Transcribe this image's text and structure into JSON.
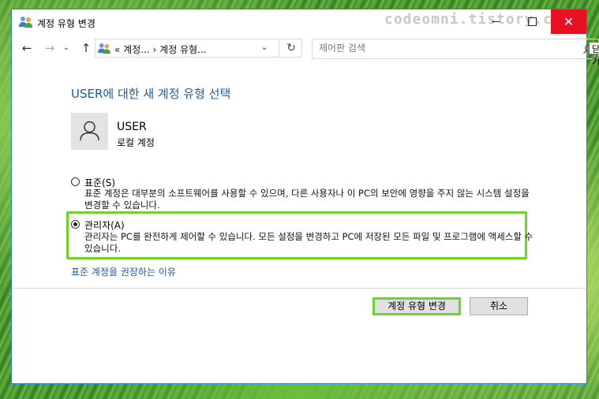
{
  "window": {
    "title": "계정 유형 변경",
    "close_tooltip": "닫기",
    "watermark": "codeomni.tistory.com"
  },
  "navigation": {
    "breadcrumb": {
      "overflow": "«",
      "items": [
        "계정...",
        "계정 유형..."
      ],
      "separator": "›"
    },
    "search": {
      "placeholder": "제어판 검색",
      "value": ""
    }
  },
  "content": {
    "heading": "USER에 대한 새 계정 유형 선택",
    "user": {
      "name": "USER",
      "account_type": "로컬 계정"
    },
    "options": [
      {
        "label": "표준(S)",
        "selected": false,
        "description": "표준 계정은 대부분의 소프트웨어를 사용할 수 있으며, 다른 사용자나 이 PC의 보안에 영향을 주지 않는 시스템 설정을 변경할 수 있습니다."
      },
      {
        "label": "관리자(A)",
        "selected": true,
        "description": "관리자는 PC를 완전하게 제어할 수 있습니다. 모든 설정을 변경하고 PC에 저장된 모든 파일 및 프로그램에 액세스할 수 있습니다."
      }
    ],
    "why_link": "표준 계정을 권장하는 이유"
  },
  "buttons": {
    "change": "계정 유형 변경",
    "cancel": "취소"
  },
  "colors": {
    "accent_blue": "#1e5aa8",
    "highlight_green": "#6fd426",
    "close_red": "#e81123"
  }
}
